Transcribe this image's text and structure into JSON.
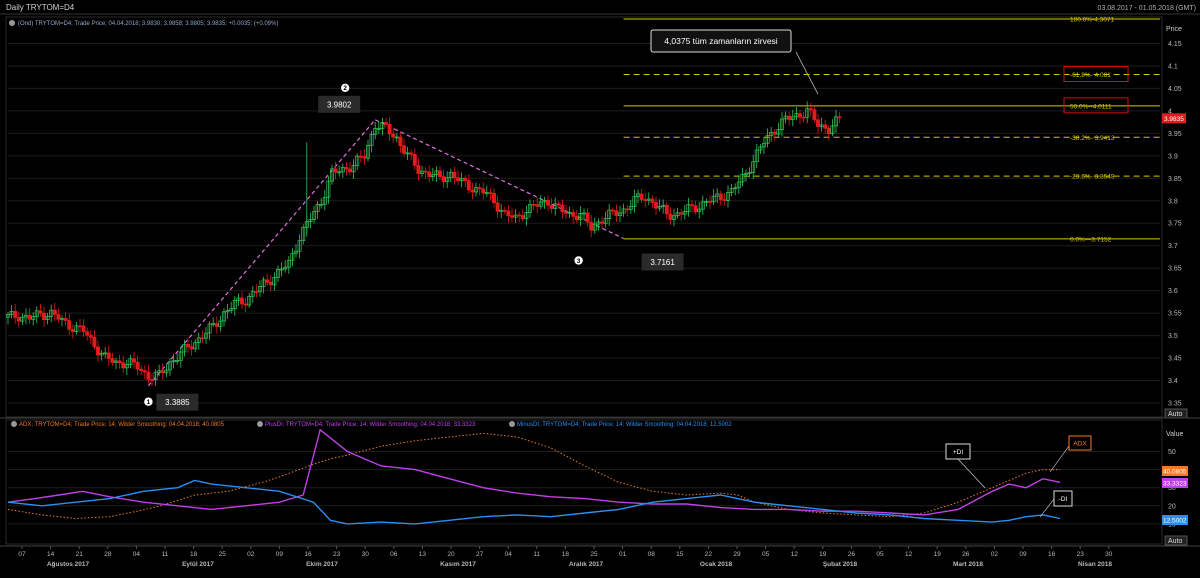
{
  "window": {
    "title": "Daily TRYTOM=D4",
    "date_range": "03.08.2017 - 01.05.2018 (GMT)"
  },
  "colors": {
    "background": "#000000",
    "up_candle": "#34c759",
    "down_candle": "#e21b1b",
    "trend_line": "#e070e0",
    "fib_line": "#d8c800",
    "adx": "#f07a2a",
    "plus_di": "#c040e8",
    "minus_di": "#2a8ff0",
    "grid": "#1e1e1e",
    "axis_text": "#b8b8b8"
  },
  "chart_data": [
    {
      "type": "candlestick",
      "title": "Daily TRYTOM=D4",
      "legend": "(Ond) TRYTOM=D4; Trade Price; 04.04.2018; 3.9830; 3.9858; 3.9805; 3.9835; +0.0035; (+0.09%)",
      "y_axis_label": "Price",
      "ylim": [
        3.33,
        4.18
      ],
      "y_ticks": [
        "4.15",
        "4.1",
        "4.05",
        "4",
        "3.95",
        "3.9",
        "3.85",
        "3.8",
        "3.75",
        "3.7",
        "3.65",
        "3.6",
        "3.55",
        "3.5",
        "3.45",
        "3.4",
        "3.35"
      ],
      "scale_button": "Auto",
      "last_price_label": "3.9835",
      "price_series": [
        [
          0,
          3.541
        ],
        [
          3,
          3.545
        ],
        [
          6,
          3.538
        ],
        [
          9,
          3.548
        ],
        [
          12,
          3.55
        ],
        [
          15,
          3.532
        ],
        [
          18,
          3.52
        ],
        [
          21,
          3.51
        ],
        [
          24,
          3.48
        ],
        [
          27,
          3.45
        ],
        [
          30,
          3.44
        ],
        [
          33,
          3.44
        ],
        [
          36,
          3.43
        ],
        [
          39,
          3.41
        ],
        [
          42,
          3.41
        ],
        [
          45,
          3.44
        ],
        [
          48,
          3.46
        ],
        [
          51,
          3.48
        ],
        [
          54,
          3.5
        ],
        [
          57,
          3.52
        ],
        [
          60,
          3.55
        ],
        [
          63,
          3.57
        ],
        [
          66,
          3.58
        ],
        [
          69,
          3.6
        ],
        [
          72,
          3.62
        ],
        [
          75,
          3.64
        ],
        [
          78,
          3.66
        ],
        [
          81,
          3.72
        ],
        [
          84,
          3.76
        ],
        [
          87,
          3.8
        ],
        [
          90,
          3.86
        ],
        [
          93,
          3.87
        ],
        [
          96,
          3.88
        ],
        [
          99,
          3.9
        ],
        [
          102,
          3.97
        ],
        [
          105,
          3.96
        ],
        [
          108,
          3.94
        ],
        [
          111,
          3.9
        ],
        [
          114,
          3.87
        ],
        [
          117,
          3.86
        ],
        [
          120,
          3.85
        ],
        [
          123,
          3.86
        ],
        [
          126,
          3.84
        ],
        [
          129,
          3.83
        ],
        [
          132,
          3.82
        ],
        [
          135,
          3.8
        ],
        [
          138,
          3.77
        ],
        [
          141,
          3.76
        ],
        [
          144,
          3.78
        ],
        [
          147,
          3.79
        ],
        [
          150,
          3.8
        ],
        [
          153,
          3.78
        ],
        [
          156,
          3.77
        ],
        [
          159,
          3.77
        ],
        [
          162,
          3.74
        ],
        [
          165,
          3.76
        ],
        [
          168,
          3.77
        ],
        [
          171,
          3.78
        ],
        [
          174,
          3.8
        ],
        [
          177,
          3.81
        ],
        [
          180,
          3.79
        ],
        [
          183,
          3.77
        ],
        [
          186,
          3.77
        ],
        [
          189,
          3.78
        ],
        [
          192,
          3.79
        ],
        [
          195,
          3.8
        ],
        [
          198,
          3.81
        ],
        [
          201,
          3.82
        ],
        [
          204,
          3.85
        ],
        [
          207,
          3.89
        ],
        [
          210,
          3.93
        ],
        [
          213,
          3.96
        ],
        [
          216,
          3.98
        ],
        [
          219,
          3.99
        ],
        [
          222,
          4.0
        ],
        [
          225,
          3.97
        ],
        [
          228,
          3.96
        ],
        [
          231,
          3.98
        ]
      ],
      "annotations": [
        {
          "marker": "1",
          "label": "3.3885",
          "x": 39,
          "y": 3.3885
        },
        {
          "marker": "2",
          "label": "3.9802",
          "x": 102,
          "y": 3.9802
        },
        {
          "marker": "3",
          "label": "3.7161",
          "x": 171,
          "y": 3.7161
        }
      ],
      "callout": {
        "text": "4,0375 tüm zamanların zirvesi",
        "x": 225,
        "y": 4.0375
      },
      "trend_lines": [
        {
          "from": [
            39,
            3.3885
          ],
          "to": [
            102,
            3.9802
          ]
        },
        {
          "from": [
            102,
            3.9802
          ],
          "to": [
            171,
            3.7161
          ]
        }
      ],
      "fibonacci": {
        "x_start": 171,
        "levels": [
          {
            "label": "100.0%-4.3071",
            "value": 4.3071,
            "solid": true
          },
          {
            "label": "-61.8%- 4.081",
            "value": 4.081,
            "solid": false,
            "boxed": true
          },
          {
            "label": "50.0%--4.0111",
            "value": 4.0111,
            "solid": true,
            "boxed": true
          },
          {
            "label": "-38.2%- 3.9413",
            "value": 3.9413,
            "solid": false
          },
          {
            "label": "-23.6%- 3.8549",
            "value": 3.8549,
            "solid": false
          },
          {
            "label": "0.0%---3.7152",
            "value": 3.7152,
            "solid": true
          }
        ]
      }
    },
    {
      "type": "line",
      "y_axis_label": "Value",
      "legends": [
        {
          "text": "ADX; TRYTOM=D4; Trade Price;  14; Wilder Smoothing; 04.04.2018; 40.0805",
          "color": "#f07a2a"
        },
        {
          "text": "PlusDI; TRYTOM=D4; Trade Price;  14; Wilder Smoothing; 04.04.2018; 33.3323",
          "color": "#c040e8"
        },
        {
          "text": "MinusDI; TRYTOM=D4; Trade Price;  14; Wilder Smoothing; 04.04.2018; 12.5002",
          "color": "#2a8ff0"
        }
      ],
      "ylim": [
        0,
        63
      ],
      "y_ticks": [
        "50",
        "40",
        "30",
        "20",
        "10"
      ],
      "series": [
        {
          "name": "ADX",
          "style": "dotted",
          "color": "#f07a2a",
          "last_label": "40.0805",
          "points": [
            [
              0,
              18
            ],
            [
              10,
              15
            ],
            [
              20,
              13
            ],
            [
              30,
              14
            ],
            [
              38,
              17
            ],
            [
              45,
              20
            ],
            [
              55,
              26
            ],
            [
              65,
              28
            ],
            [
              75,
              33
            ],
            [
              80,
              36
            ],
            [
              90,
              43
            ],
            [
              95,
              46
            ],
            [
              100,
              48
            ],
            [
              110,
              53
            ],
            [
              120,
              56
            ],
            [
              130,
              58
            ],
            [
              140,
              60
            ],
            [
              150,
              58
            ],
            [
              160,
              52
            ],
            [
              170,
              42
            ],
            [
              180,
              33
            ],
            [
              190,
              28
            ],
            [
              200,
              26
            ],
            [
              210,
              27
            ],
            [
              215,
              26
            ],
            [
              220,
              22
            ],
            [
              225,
              20
            ],
            [
              230,
              18
            ],
            [
              240,
              16
            ],
            [
              250,
              15
            ],
            [
              260,
              14
            ],
            [
              270,
              16
            ],
            [
              280,
              22
            ],
            [
              290,
              30
            ],
            [
              300,
              38
            ],
            [
              305,
              40
            ],
            [
              310,
              40
            ]
          ]
        },
        {
          "name": "+DI",
          "style": "solid",
          "color": "#c040e8",
          "last_label": "33.3323",
          "points": [
            [
              0,
              22
            ],
            [
              8,
              24
            ],
            [
              15,
              26
            ],
            [
              22,
              28
            ],
            [
              30,
              25
            ],
            [
              40,
              22
            ],
            [
              50,
              20
            ],
            [
              60,
              18
            ],
            [
              70,
              20
            ],
            [
              80,
              22
            ],
            [
              87,
              26
            ],
            [
              92,
              62
            ],
            [
              100,
              50
            ],
            [
              110,
              42
            ],
            [
              120,
              40
            ],
            [
              130,
              35
            ],
            [
              140,
              30
            ],
            [
              150,
              27
            ],
            [
              160,
              25
            ],
            [
              170,
              24
            ],
            [
              180,
              22
            ],
            [
              190,
              21
            ],
            [
              200,
              21
            ],
            [
              210,
              19
            ],
            [
              220,
              18
            ],
            [
              230,
              18
            ],
            [
              240,
              17
            ],
            [
              250,
              17
            ],
            [
              260,
              16
            ],
            [
              270,
              15
            ],
            [
              280,
              18
            ],
            [
              290,
              28
            ],
            [
              295,
              32
            ],
            [
              300,
              30
            ],
            [
              305,
              35
            ],
            [
              310,
              33
            ]
          ]
        },
        {
          "name": "-DI",
          "style": "solid",
          "color": "#2a8ff0",
          "last_label": "12.5002",
          "points": [
            [
              0,
              22
            ],
            [
              10,
              20
            ],
            [
              20,
              22
            ],
            [
              30,
              24
            ],
            [
              40,
              28
            ],
            [
              50,
              30
            ],
            [
              55,
              34
            ],
            [
              60,
              32
            ],
            [
              70,
              30
            ],
            [
              80,
              28
            ],
            [
              90,
              22
            ],
            [
              95,
              12
            ],
            [
              100,
              10
            ],
            [
              110,
              11
            ],
            [
              120,
              10
            ],
            [
              130,
              12
            ],
            [
              140,
              14
            ],
            [
              150,
              15
            ],
            [
              160,
              14
            ],
            [
              170,
              16
            ],
            [
              180,
              18
            ],
            [
              190,
              22
            ],
            [
              200,
              24
            ],
            [
              210,
              26
            ],
            [
              220,
              22
            ],
            [
              230,
              20
            ],
            [
              240,
              18
            ],
            [
              250,
              16
            ],
            [
              260,
              15
            ],
            [
              270,
              13
            ],
            [
              280,
              12
            ],
            [
              290,
              11
            ],
            [
              295,
              12
            ],
            [
              300,
              14
            ],
            [
              305,
              15
            ],
            [
              310,
              13
            ]
          ]
        }
      ],
      "labels": [
        {
          "text": "ADX",
          "color": "#f07a2a"
        },
        {
          "text": "+DI",
          "color": "#ffffff"
        },
        {
          "text": "-DI",
          "color": "#ffffff"
        }
      ],
      "scale_button": "Auto"
    }
  ],
  "x_axis": {
    "day_ticks": [
      "07",
      "14",
      "21",
      "28",
      "04",
      "11",
      "18",
      "25",
      "02",
      "09",
      "16",
      "23",
      "30",
      "06",
      "13",
      "20",
      "27",
      "04",
      "11",
      "18",
      "25",
      "01",
      "08",
      "15",
      "22",
      "29",
      "05",
      "12",
      "19",
      "26",
      "05",
      "12",
      "19",
      "26",
      "02",
      "09",
      "16",
      "23",
      "30"
    ],
    "months": [
      "Ağustos 2017",
      "Eylül 2017",
      "Ekim 2017",
      "Kasım 2017",
      "Aralık 2017",
      "Ocak 2018",
      "Şubat 2018",
      "Mart 2018",
      "Nisan 2018"
    ]
  }
}
